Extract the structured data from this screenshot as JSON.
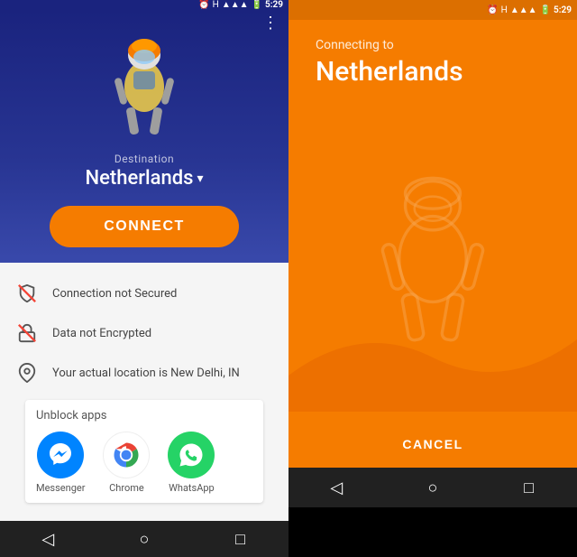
{
  "screens": {
    "left": {
      "status_bar": {
        "time": "5:29",
        "icons": [
          "alarm",
          "H",
          "signal",
          "wifi",
          "battery"
        ]
      },
      "hero": {
        "destination_label": "Destination",
        "destination_value": "Netherlands",
        "connect_button": "CONNECT",
        "three_dots": "⋮"
      },
      "info_rows": [
        {
          "icon": "🔕",
          "text": "Connection not Secured"
        },
        {
          "icon": "🔒",
          "text": "Data not Encrypted"
        },
        {
          "icon": "➤",
          "text": "Your actual location is New Delhi, IN"
        }
      ],
      "unblock_card": {
        "title": "Unblock apps",
        "apps": [
          {
            "name": "Messenger",
            "color": "#0084ff"
          },
          {
            "name": "Chrome",
            "color": "#fff"
          },
          {
            "name": "WhatsApp",
            "color": "#25d366"
          }
        ]
      },
      "nav": {
        "back": "◁",
        "home": "○",
        "recent": "□"
      }
    },
    "right": {
      "status_bar": {
        "time": "5:29",
        "icons": [
          "alarm",
          "H",
          "signal",
          "wifi",
          "battery"
        ]
      },
      "connecting_to_label": "Connecting to",
      "destination": "Netherlands",
      "cancel_button": "CANCEL",
      "nav": {
        "back": "◁",
        "home": "○",
        "recent": "□"
      }
    }
  }
}
